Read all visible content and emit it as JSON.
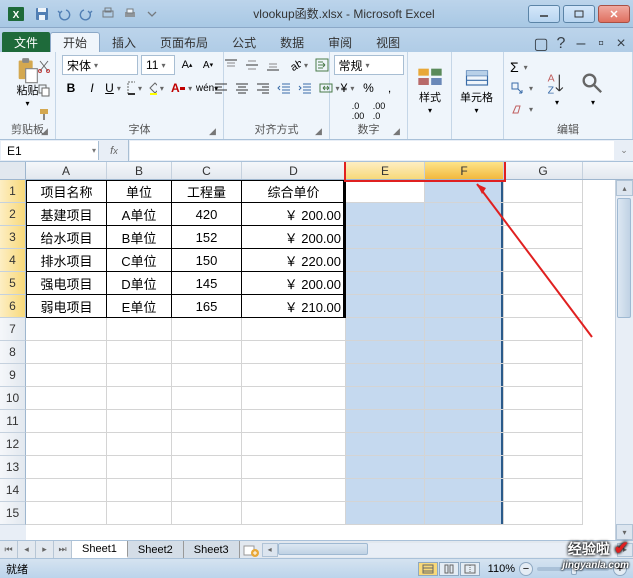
{
  "window": {
    "title": "vlookup函数.xlsx - Microsoft Excel"
  },
  "tabs": {
    "file": "文件",
    "items": [
      "开始",
      "插入",
      "页面布局",
      "公式",
      "数据",
      "审阅",
      "视图"
    ],
    "active": 0
  },
  "ribbon": {
    "clipboard": {
      "label": "剪贴板",
      "paste": "粘贴"
    },
    "font": {
      "label": "字体",
      "name": "宋体",
      "size": "11"
    },
    "alignment": {
      "label": "对齐方式"
    },
    "number": {
      "label": "数字",
      "format": "常规",
      "currency": "¥",
      "percent": "%"
    },
    "styles": {
      "label": "样式"
    },
    "cells": {
      "label": "单元格"
    },
    "editing": {
      "label": "编辑"
    }
  },
  "namebox": "E1",
  "columns": {
    "widths": {
      "A": 81,
      "B": 65,
      "C": 70,
      "D": 104,
      "E": 79,
      "F": 79,
      "G": 79
    },
    "labels": [
      "A",
      "B",
      "C",
      "D",
      "E",
      "F",
      "G"
    ]
  },
  "rows": {
    "count": 15,
    "height": 23
  },
  "chart_data": {
    "type": "table",
    "headers": [
      "项目名称",
      "单位",
      "工程量",
      "综合单价"
    ],
    "rows": [
      [
        "基建项目",
        "A单位",
        "420",
        "￥   200.00"
      ],
      [
        "给水项目",
        "B单位",
        "152",
        "￥   200.00"
      ],
      [
        "排水项目",
        "C单位",
        "150",
        "￥   220.00"
      ],
      [
        "强电项目",
        "D单位",
        "145",
        "￥   200.00"
      ],
      [
        "弱电项目",
        "E单位",
        "165",
        "￥   210.00"
      ]
    ]
  },
  "sheets": {
    "items": [
      "Sheet1",
      "Sheet2",
      "Sheet3"
    ],
    "active": 0
  },
  "status": {
    "ready": "就绪",
    "zoom": "110%"
  },
  "watermark": {
    "text": "经验啦",
    "url": "jingyanla.com"
  }
}
